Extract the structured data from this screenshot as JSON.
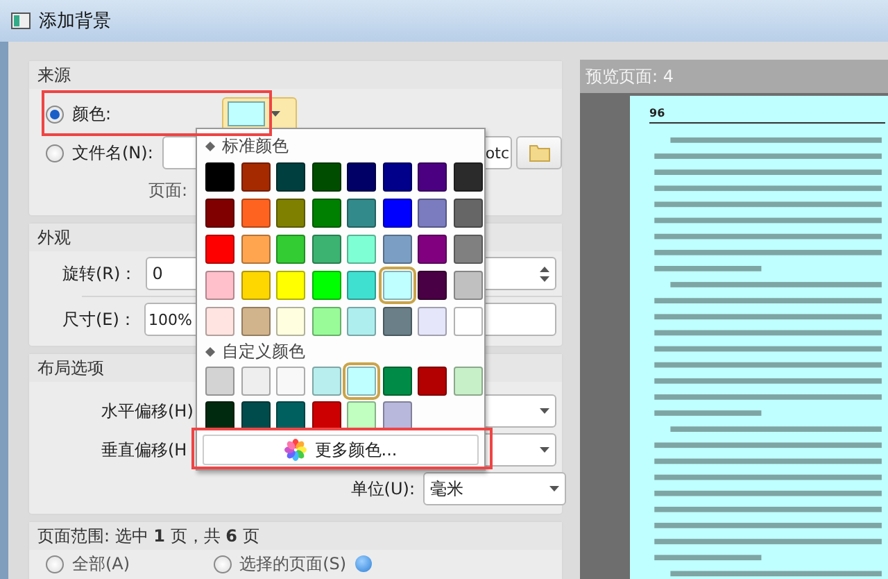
{
  "window": {
    "title": "添加背景"
  },
  "source": {
    "title": "来源",
    "options": [
      {
        "label": "颜色:",
        "selected": true
      },
      {
        "label": "文件名(N):",
        "selected": false
      }
    ],
    "color_button": {
      "color": "#bfffff"
    },
    "filename_field": {
      "value": "otc"
    },
    "page_label": "页面:"
  },
  "appearance": {
    "title": "外观",
    "rotation": {
      "label": "旋转(R)：",
      "value": "0"
    },
    "size": {
      "label": "尺寸(E)：",
      "value": "100%"
    }
  },
  "layout": {
    "title": "布局选项",
    "fields": [
      {
        "label": "水平偏移(H)"
      },
      {
        "label": "垂直偏移(H"
      },
      {
        "label": "单位(U):",
        "value": "毫米"
      }
    ]
  },
  "page_range": {
    "text": "页面范围: 选中 **1** 页，共 **6** 页",
    "options": [
      {
        "label": "全部(A)",
        "selected": false
      },
      {
        "label": "选择的页面(S)",
        "selected": false
      }
    ]
  },
  "preview": {
    "title": "预览页面: 4",
    "page_number": "96"
  },
  "color_popup": {
    "standard_title": "标准颜色",
    "standard_colors": [
      {
        "color": "#000000",
        "selected": false
      },
      {
        "color": "#a52a00",
        "selected": false
      },
      {
        "color": "#003f3f",
        "selected": false
      },
      {
        "color": "#004d00",
        "selected": false
      },
      {
        "color": "#000066",
        "selected": false
      },
      {
        "color": "#00008b",
        "selected": false
      },
      {
        "color": "#4b0082",
        "selected": false
      },
      {
        "color": "#2b2b2b",
        "selected": false
      },
      {
        "color": "#800000",
        "selected": false
      },
      {
        "color": "#ff6320",
        "selected": false
      },
      {
        "color": "#808000",
        "selected": false
      },
      {
        "color": "#008000",
        "selected": false
      },
      {
        "color": "#338a8a",
        "selected": false
      },
      {
        "color": "#0000ff",
        "selected": false
      },
      {
        "color": "#7b7bc0",
        "selected": false
      },
      {
        "color": "#666666",
        "selected": false
      },
      {
        "color": "#ff0000",
        "selected": false
      },
      {
        "color": "#ffa550",
        "selected": false
      },
      {
        "color": "#33cc33",
        "selected": false
      },
      {
        "color": "#3cb371",
        "selected": false
      },
      {
        "color": "#7fffd4",
        "selected": false
      },
      {
        "color": "#7b9ec4",
        "selected": false
      },
      {
        "color": "#800080",
        "selected": false
      },
      {
        "color": "#808080",
        "selected": false
      },
      {
        "color": "#ffc0cb",
        "selected": false
      },
      {
        "color": "#ffd700",
        "selected": false
      },
      {
        "color": "#ffff00",
        "selected": false
      },
      {
        "color": "#00ff00",
        "selected": false
      },
      {
        "color": "#40e0d0",
        "selected": false
      },
      {
        "color": "#bfffff",
        "selected": true
      },
      {
        "color": "#4a0044",
        "selected": false
      },
      {
        "color": "#c0c0c0",
        "selected": false
      },
      {
        "color": "#ffe4e1",
        "selected": false
      },
      {
        "color": "#d2b48c",
        "selected": false
      },
      {
        "color": "#ffffe0",
        "selected": false
      },
      {
        "color": "#98fb98",
        "selected": false
      },
      {
        "color": "#afeeee",
        "selected": false
      },
      {
        "color": "#6a7f88",
        "selected": false
      },
      {
        "color": "#e6e6fa",
        "selected": false
      },
      {
        "color": "#ffffff",
        "selected": false
      }
    ],
    "custom_title": "自定义颜色",
    "custom_colors": [
      {
        "color": "#d3d3d3",
        "selected": false
      },
      {
        "color": "#eeeeee",
        "selected": false
      },
      {
        "color": "#f8f8f8",
        "selected": false
      },
      {
        "color": "#b8eeee",
        "selected": false
      },
      {
        "color": "#bfffff",
        "selected": true
      },
      {
        "color": "#008c46",
        "selected": false
      },
      {
        "color": "#b30000",
        "selected": false
      },
      {
        "color": "#c8f0c8",
        "selected": false
      },
      {
        "color": "#002a10",
        "selected": false
      },
      {
        "color": "#004c4c",
        "selected": false
      },
      {
        "color": "#006060",
        "selected": false
      },
      {
        "color": "#cc0000",
        "selected": false
      },
      {
        "color": "#c0ffc0",
        "selected": false
      },
      {
        "color": "#b8b8dd",
        "selected": false
      }
    ],
    "more_button": "更多颜色..."
  }
}
